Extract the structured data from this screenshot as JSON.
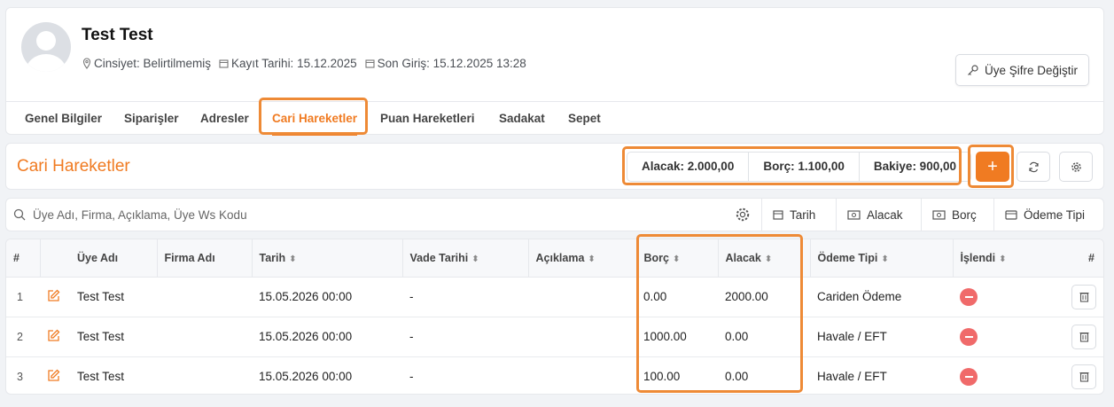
{
  "profile": {
    "name": "Test Test",
    "gender": "Cinsiyet: Belirtilmemiş",
    "registered": "Kayıt Tarihi: 15.12.2025",
    "last_login": "Son Giriş: 15.12.2025 13:28",
    "change_password_label": "Üye Şifre Değiştir"
  },
  "tabs": [
    {
      "label": "Genel Bilgiler"
    },
    {
      "label": "Siparişler"
    },
    {
      "label": "Adresler"
    },
    {
      "label": "Cari Hareketler",
      "active": true
    },
    {
      "label": "Puan Hareketleri"
    },
    {
      "label": "Sadakat"
    },
    {
      "label": "Sepet"
    }
  ],
  "section": {
    "title": "Cari Hareketler",
    "summary": {
      "alacak": "Alacak: 2.000,00",
      "borc": "Borç: 1.100,00",
      "bakiye": "Bakiye: 900,00"
    },
    "add_label": "+"
  },
  "filter": {
    "search_placeholder": "Üye Adı, Firma, Açıklama, Üye Ws Kodu",
    "buttons": [
      "Tarih",
      "Alacak",
      "Borç",
      "Ödeme Tipi"
    ]
  },
  "table": {
    "headers": [
      "#",
      "Üye Adı",
      "Firma Adı",
      "Tarih",
      "Vade Tarihi",
      "Açıklama",
      "Borç",
      "Alacak",
      "Ödeme Tipi",
      "İşlendi",
      "#"
    ],
    "rows": [
      {
        "no": "1",
        "uye": "Test Test",
        "firma": "",
        "tarih": "15.05.2026 00:00",
        "vade": "-",
        "aciklama": "",
        "borc": "0.00",
        "alacak": "2000.00",
        "odeme": "Cariden Ödeme"
      },
      {
        "no": "2",
        "uye": "Test Test",
        "firma": "",
        "tarih": "15.05.2026 00:00",
        "vade": "-",
        "aciklama": "",
        "borc": "1000.00",
        "alacak": "0.00",
        "odeme": "Havale / EFT"
      },
      {
        "no": "3",
        "uye": "Test Test",
        "firma": "",
        "tarih": "15.05.2026 00:00",
        "vade": "-",
        "aciklama": "",
        "borc": "100.00",
        "alacak": "0.00",
        "odeme": "Havale / EFT"
      }
    ]
  },
  "colors": {
    "accent": "#f07b22",
    "highlight": "#ee8a36",
    "danger": "#f06a6a"
  }
}
